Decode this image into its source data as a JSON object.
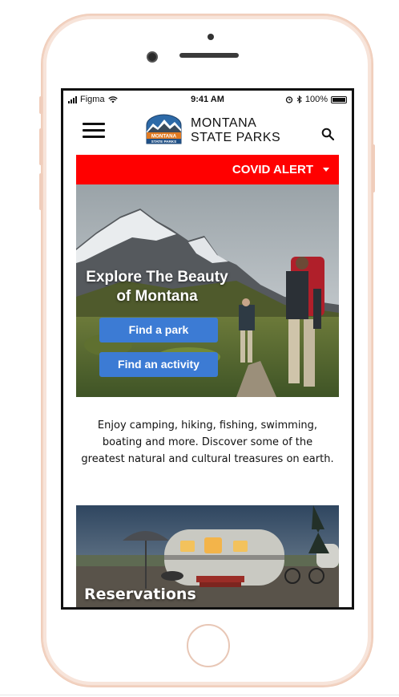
{
  "status_bar": {
    "carrier": "Figma",
    "time": "9:41 AM",
    "battery": "100%"
  },
  "header": {
    "brand_line1": "MONTANA",
    "brand_line2": "STATE PARKS",
    "logo_text_line1": "MONTANA",
    "logo_text_line2": "STATE PARKS"
  },
  "alert": {
    "label": "COVID ALERT"
  },
  "hero": {
    "title_line1": "Explore The Beauty",
    "title_line2": "of Montana",
    "find_park": "Find a park",
    "find_activity": "Find an activity"
  },
  "intro": {
    "text": "Enjoy camping, hiking, fishing, swimming, boating and more. Discover some of the greatest natural and cultural treasures on earth."
  },
  "reservations": {
    "title": "Reservations"
  },
  "colors": {
    "alert_red": "#ff0000",
    "button_blue": "#3c7bd4",
    "phone_frame": "#f2d3c2"
  }
}
